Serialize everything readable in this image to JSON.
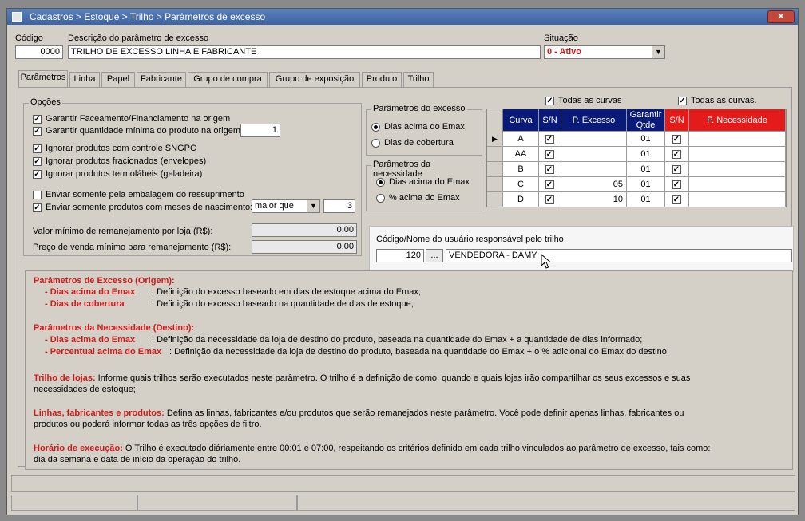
{
  "window": {
    "title": "Cadastros > Estoque > Trilho > Parâmetros de excesso",
    "close_label": "✕"
  },
  "header": {
    "codigo_label": "Código",
    "codigo_value": "0000",
    "descricao_label": "Descrição do parâmetro de excesso",
    "descricao_value": "TRILHO DE EXCESSO LINHA E FABRICANTE",
    "situacao_label": "Situação",
    "situacao_value": "0 - Ativo"
  },
  "tabs": [
    "Parâmetros",
    "Linha",
    "Papel",
    "Fabricante",
    "Grupo de compra",
    "Grupo de exposição",
    "Produto",
    "Trilho"
  ],
  "opcoes": {
    "title": "Opções",
    "items": [
      {
        "label": "Garantir Faceamento/Financiamento na origem",
        "checked": true
      },
      {
        "label": "Garantir quantidade mínima do produto na origem:",
        "checked": true
      },
      {
        "label": "Ignorar produtos com controle SNGPC",
        "checked": true
      },
      {
        "label": "Ignorar produtos fracionados (envelopes)",
        "checked": true
      },
      {
        "label": "Ignorar produtos termolábeis (geladeira)",
        "checked": true
      },
      {
        "label": "Enviar somente pela embalagem do ressuprimento",
        "checked": false
      },
      {
        "label": "Enviar somente produtos com meses de nascimento:",
        "checked": true
      }
    ],
    "qtd_minima": "1",
    "meses_operador": "maior que",
    "meses_valor": "3",
    "valor_minimo_label": "Valor mínimo de remanejamento por loja (R$):",
    "valor_minimo": "0,00",
    "preco_venda_label": "Preço de venda mínimo para remanejamento (R$):",
    "preco_venda": "0,00"
  },
  "param_excesso": {
    "title": "Parâmetros do excesso",
    "options": [
      "Dias acima do Emax",
      "Dias de cobertura"
    ],
    "selected": 0
  },
  "param_necessidade": {
    "title": "Parâmetros da necessidade",
    "options": [
      "Dias acima do Emax",
      "% acima do Emax"
    ],
    "selected": 0
  },
  "grid": {
    "todas_curvas_1": "Todas as curvas",
    "todas_curvas_2": "Todas as curvas.",
    "headers": [
      "Curva",
      "S/N",
      "P. Excesso",
      "Garantir Qtde",
      "S/N",
      "P. Necessidade"
    ],
    "rows": [
      {
        "curva": "A",
        "sn1": true,
        "p_excesso": "",
        "garantir": "01",
        "sn2": true,
        "p_necessidade": ""
      },
      {
        "curva": "AA",
        "sn1": true,
        "p_excesso": "",
        "garantir": "01",
        "sn2": true,
        "p_necessidade": ""
      },
      {
        "curva": "B",
        "sn1": true,
        "p_excesso": "",
        "garantir": "01",
        "sn2": true,
        "p_necessidade": ""
      },
      {
        "curva": "C",
        "sn1": true,
        "p_excesso": "05",
        "garantir": "01",
        "sn2": true,
        "p_necessidade": ""
      },
      {
        "curva": "D",
        "sn1": true,
        "p_excesso": "10",
        "garantir": "01",
        "sn2": true,
        "p_necessidade": ""
      }
    ]
  },
  "usuario": {
    "label": "Código/Nome do usuário responsável pelo trilho",
    "codigo": "120",
    "button": "...",
    "nome": "VENDEDORA - DAMY"
  },
  "help": {
    "s1_title": "Parâmetros de Excesso (Origem):",
    "s1_a_term": "- Dias acima do Emax",
    "s1_a_desc": ": Definição do excesso baseado em dias de estoque acima do Emax;",
    "s1_b_term": "- Dias de cobertura",
    "s1_b_desc": ": Definição do excesso baseado na quantidade de dias de estoque;",
    "s2_title": "Parâmetros da Necessidade (Destino):",
    "s2_a_term": "- Dias acima do Emax",
    "s2_a_desc": ": Definição da necessidade da loja de destino do produto, baseada na quantidade do Emax + a quantidade de dias informado;",
    "s2_b_term": "- Percentual acima do Emax",
    "s2_b_desc": ": Definição da necessidade da loja de destino do produto, baseada na quantidade do Emax + o % adicional do Emax do destino;",
    "s3_term": "Trilho de lojas:",
    "s3_line1": " Informe quais trilhos serão executados neste parâmetro. O trilho é a definição de como, quando e quais lojas irão compartilhar os seus excessos e suas",
    "s3_line2": "necessidades de estoque;",
    "s4_term": "Linhas, fabricantes e produtos:",
    "s4_line1": " Defina as linhas, fabricantes e/ou produtos que serão remanejados neste parâmetro. Você pode definir apenas linhas, fabricantes ou",
    "s4_line2": "produtos ou poderá informar todas as três opções de filtro.",
    "s5_term": "Horário de execução:",
    "s5_line1": " O Trilho é executado diáriamente entre 00:01 e 07:00, respeitando os critérios definido em cada trilho vinculados ao parâmetro de excesso, tais como:",
    "s5_line2": "dia da semana e data de início da operação do trilho."
  }
}
